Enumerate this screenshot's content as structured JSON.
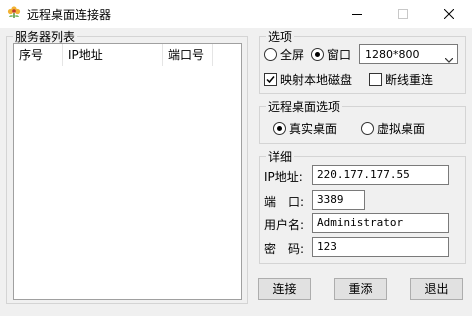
{
  "window": {
    "title": "远程桌面连接器",
    "icon": "flower-icon",
    "controls": [
      "minimize-icon",
      "maximize-icon",
      "close-icon"
    ]
  },
  "server_list": {
    "title": "服务器列表",
    "columns": [
      "序号",
      "IP地址",
      "端口号"
    ],
    "rows": []
  },
  "options": {
    "title": "选项",
    "fullscreen_label": "全屏",
    "window_label": "窗口",
    "display_mode": "window",
    "resolution": "1280*800",
    "map_disk_label": "映射本地磁盘",
    "map_disk_checked": true,
    "reconnect_label": "断线重连",
    "reconnect_checked": false
  },
  "desktop_options": {
    "title": "远程桌面选项",
    "real_label": "真实桌面",
    "virtual_label": "虚拟桌面",
    "selected": "real"
  },
  "details": {
    "title": "详细",
    "ip_label": "IP地址:",
    "ip_value": "220.177.177.55",
    "port_label": "端　口:",
    "port_value": "3389",
    "user_label": "用户名:",
    "user_value": "Administrator",
    "password_label": "密　码:",
    "password_value": "123"
  },
  "buttons": {
    "connect": "连接",
    "add": "重添",
    "exit": "退出"
  }
}
